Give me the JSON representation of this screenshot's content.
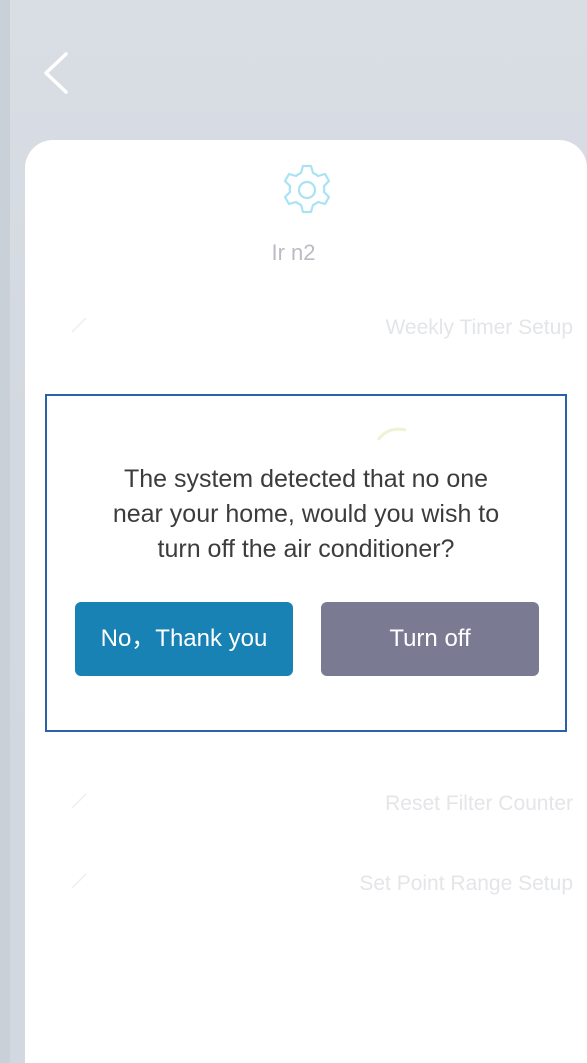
{
  "header": {
    "back_icon": "chevron-left-icon"
  },
  "device": {
    "icon": "gear-icon",
    "name": "Ir n2"
  },
  "menu": {
    "items": [
      {
        "label": "Weekly Timer Setup"
      },
      {
        "label": "Reset Filter Counter"
      },
      {
        "label": "Set Point Range Setup"
      }
    ]
  },
  "dialog": {
    "message_line1": "The system detected that no one",
    "message_line2": "near your home, would you wish to",
    "message_line3": "turn off the air conditioner?",
    "no_label": "No，Thank you",
    "off_label": "Turn off"
  },
  "colors": {
    "accent": "#1782b3",
    "secondary_button": "#7a7b93",
    "dialog_border": "#2a62a8",
    "icon_tint": "#9fdff0"
  }
}
